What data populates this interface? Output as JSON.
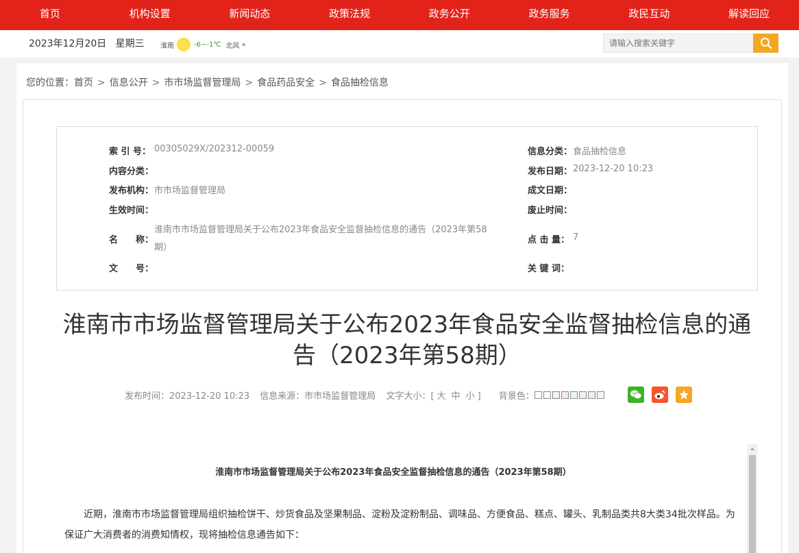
{
  "nav": {
    "items": [
      "首页",
      "机构设置",
      "新闻动态",
      "政策法规",
      "政务公开",
      "政务服务",
      "政民互动",
      "解读回应"
    ]
  },
  "topbar": {
    "date": "2023年12月20日",
    "weekday": "星期三",
    "weather_city": "淮南",
    "weather_temp": "-6~-1℃",
    "weather_wind": "北风",
    "weather_more": "»",
    "weather_icon": "sun-icon",
    "search_placeholder": "请输入搜索关键字",
    "search_icon": "search-icon"
  },
  "breadcrumb": {
    "prefix": "您的位置：",
    "items": [
      "首页",
      "信息公开",
      "市市场监督管理局",
      "食品药品安全",
      "食品抽检信息"
    ],
    "separator": ">"
  },
  "info": {
    "index_label": "索 引 号：",
    "index_value": "00305029X/202312-00059",
    "category_label": "信息分类：",
    "category_value": "食品抽检信息",
    "content_label": "内容分类：",
    "content_value": "",
    "pubdate_label": "发布日期：",
    "pubdate_value": "2023-12-20 10:23",
    "org_label": "发布机构：",
    "org_value": "市市场监督管理局",
    "written_label": "成文日期：",
    "written_value": "",
    "effective_label": "生效时间：",
    "effective_value": "",
    "expire_label": "废止时间：",
    "expire_value": "",
    "name_label": "名　　称：",
    "name_value": "淮南市市场监督管理局关于公布2023年食品安全监督抽检信息的通告（2023年第58期）",
    "clicks_label": "点 击 量：",
    "clicks_value": "7",
    "docno_label": "文　　号：",
    "docno_value": "",
    "keywords_label": "关 键 词：",
    "keywords_value": ""
  },
  "article": {
    "title": "淮南市市场监督管理局关于公布2023年食品安全监督抽检信息的通告（2023年第58期）",
    "meta_time": "发布时间：2023-12-20 10:23",
    "meta_source": "信息来源：市市场监督管理局",
    "font_size_label": "文字大小：[",
    "font_large": "大",
    "font_medium": "中",
    "font_small": "小",
    "font_size_close": "]",
    "bg_label": "背景色：",
    "bg_colors": [
      "#ffffff",
      "#fafafa",
      "#fcefe8",
      "#f9e8e8",
      "#eef7e6",
      "#e6f2f8",
      "#eeeeee",
      "#f5f5f5"
    ],
    "share_icons": [
      "wechat-icon",
      "weibo-icon",
      "favorite-icon"
    ],
    "share_colors": [
      "#3db22b",
      "#f5562e",
      "#f5a623"
    ],
    "doc_title": "淮南市市场监督管理局关于公布2023年食品安全监督抽检信息的通告（2023年第58期）",
    "paragraph": "近期，淮南市市场监督管理局组织抽检饼干、炒货食品及坚果制品、淀粉及淀粉制品、调味品、方便食品、糕点、罐头、乳制品类共8大类34批次样品。为保证广大消费者的消费知情权，现将抽检信息通告如下："
  },
  "colors": {
    "nav_bg": "#e2231a",
    "search_btn": "#f5a623"
  }
}
